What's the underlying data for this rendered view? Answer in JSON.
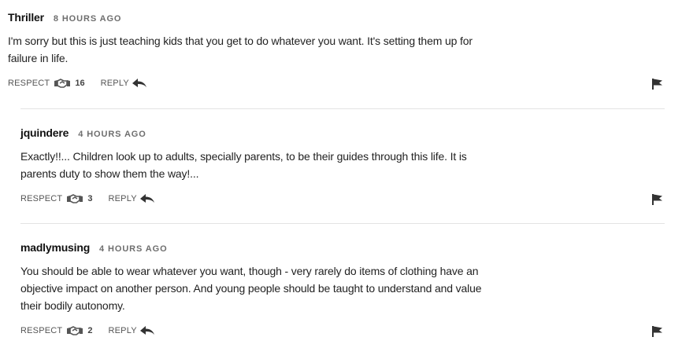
{
  "comments": [
    {
      "username": "Thriller",
      "timestamp": "8 HOURS AGO",
      "lines": [
        "I'm sorry but this is just teaching kids that you get to do whatever you want. It's setting them up for",
        "failure in life."
      ],
      "respect_label": "RESPECT",
      "respect_count": "16",
      "reply_label": "REPLY"
    },
    {
      "username": "jquindere",
      "timestamp": "4 HOURS AGO",
      "lines": [
        "Exactly!!... Children look up to adults, specially parents, to be their guides through this life. It is",
        "parents duty to show them the way!..."
      ],
      "respect_label": "RESPECT",
      "respect_count": "3",
      "reply_label": "REPLY"
    },
    {
      "username": "madlymusing",
      "timestamp": "4 HOURS AGO",
      "lines": [
        "You should be able to wear whatever you want, though - very rarely do items of clothing have an",
        "objective impact on another person. And young people should be taught to understand and value",
        "their bodily autonomy."
      ],
      "respect_label": "RESPECT",
      "respect_count": "2",
      "reply_label": "REPLY"
    }
  ],
  "icons": {
    "respect": "handshake-icon",
    "reply": "reply-arrow-icon",
    "flag": "flag-icon"
  },
  "colors": {
    "text": "#222222",
    "muted": "#6e6e6e",
    "divider": "#e3e3e3"
  }
}
